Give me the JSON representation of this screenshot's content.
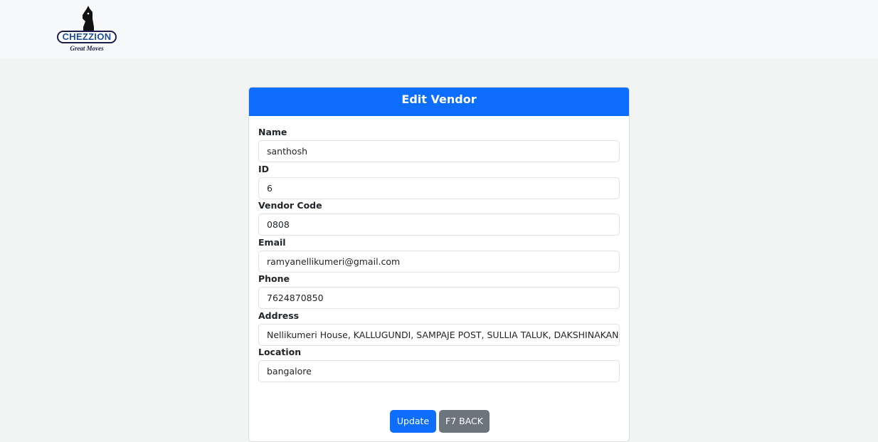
{
  "brand": {
    "logo_text": "CHEZZION",
    "tagline": "Great Moves"
  },
  "card": {
    "title": "Edit Vendor"
  },
  "fields": [
    {
      "label": "Name",
      "value": "santhosh"
    },
    {
      "label": "ID",
      "value": "6"
    },
    {
      "label": "Vendor Code",
      "value": "0808"
    },
    {
      "label": "Email",
      "value": "ramyanellikumeri@gmail.com"
    },
    {
      "label": "Phone",
      "value": "7624870850"
    },
    {
      "label": "Address",
      "value": "Nellikumeri House, KALLUGUNDI, SAMPAJE POST, SULLIA TALUK, DAKSHINAKANNADA"
    },
    {
      "label": "Location",
      "value": "bangalore"
    }
  ],
  "actions": {
    "update_label": "Update",
    "back_label": "F7 BACK"
  },
  "colors": {
    "primary": "#0d6efd",
    "secondary": "#6c757d"
  }
}
